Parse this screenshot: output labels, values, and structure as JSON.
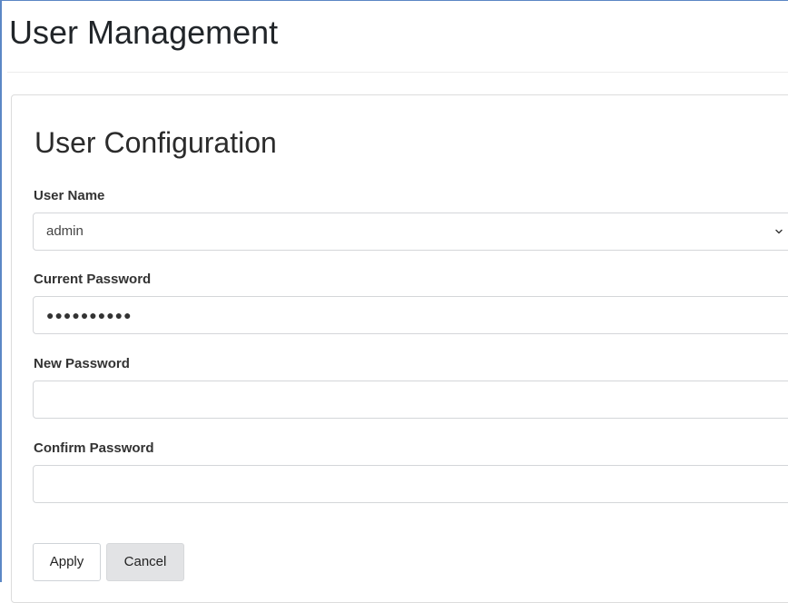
{
  "page": {
    "title": "User Management"
  },
  "form": {
    "section_title": "User Configuration",
    "user_name": {
      "label": "User Name",
      "selected_value": "admin"
    },
    "current_password": {
      "label": "Current Password",
      "masked_value": "●●●●●●●●●●"
    },
    "new_password": {
      "label": "New Password",
      "value": ""
    },
    "confirm_password": {
      "label": "Confirm Password",
      "value": ""
    }
  },
  "buttons": {
    "apply_label": "Apply",
    "cancel_label": "Cancel"
  },
  "icons": {
    "select_arrow": "chevron-down-icon"
  },
  "colors": {
    "frame_border": "#5b87c5",
    "cancel_bg": "#e2e3e5",
    "input_border": "#d4d6d9"
  }
}
